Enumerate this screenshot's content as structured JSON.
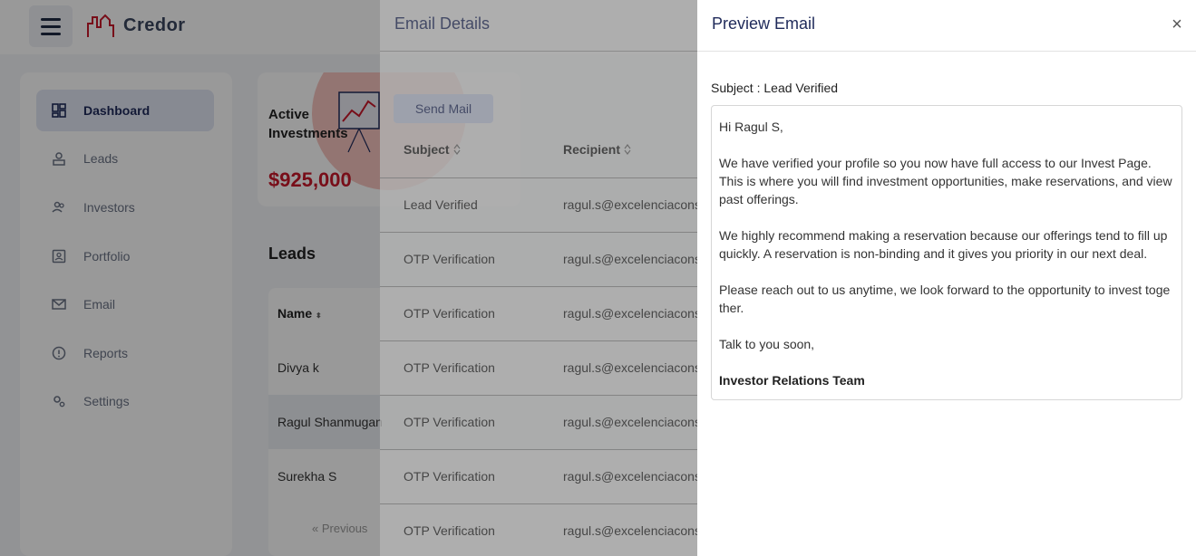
{
  "app": {
    "brand": "Credor"
  },
  "sidebar": {
    "items": [
      {
        "label": "Dashboard",
        "icon": "dashboard-icon"
      },
      {
        "label": "Leads",
        "icon": "leads-icon"
      },
      {
        "label": "Investors",
        "icon": "investors-icon"
      },
      {
        "label": "Portfolio",
        "icon": "portfolio-icon"
      },
      {
        "label": "Email",
        "icon": "email-icon"
      },
      {
        "label": "Reports",
        "icon": "reports-icon"
      },
      {
        "label": "Settings",
        "icon": "settings-icon"
      }
    ],
    "active": "Dashboard"
  },
  "dashboard": {
    "active_investments": {
      "title": "Active Investments",
      "value": "$925,000"
    },
    "leads": {
      "title": "Leads",
      "name_header": "Name",
      "rows": [
        "Divya k",
        "Ragul Shanmugan",
        "Surekha S"
      ],
      "pager_prev": "« Previous"
    }
  },
  "email_details": {
    "title": "Email Details",
    "send_button": "Send Mail",
    "columns": {
      "subject": "Subject",
      "recipient": "Recipient"
    },
    "rows": [
      {
        "subject": "Lead Verified",
        "recipient": "ragul.s@excelenciacons"
      },
      {
        "subject": "OTP Verification",
        "recipient": "ragul.s@excelenciacons"
      },
      {
        "subject": "OTP Verification",
        "recipient": "ragul.s@excelenciacons"
      },
      {
        "subject": "OTP Verification",
        "recipient": "ragul.s@excelenciacons"
      },
      {
        "subject": "OTP Verification",
        "recipient": "ragul.s@excelenciacons"
      },
      {
        "subject": "OTP Verification",
        "recipient": "ragul.s@excelenciacons"
      },
      {
        "subject": "OTP Verification",
        "recipient": "ragul.s@excelenciacons"
      }
    ]
  },
  "preview": {
    "title": "Preview Email",
    "close_icon": "×",
    "subject_line": "Subject : Lead Verified",
    "body": {
      "greeting": "Hi Ragul S,",
      "p1": "We have verified your profile so you now have full access to our Invest Page. This is where you will find investment opportunities, make reservations, and view past offerings.",
      "p2": "We highly recommend making a reservation because our offerings tend to fill up quickly. A reservation is non-binding and it gives you priority in our next deal.",
      "p3": "Please reach out to us anytime, we look forward to the opportunity to invest toge ther.",
      "closing": "Talk to you soon,",
      "signature": "Investor Relations Team"
    }
  },
  "colors": {
    "brand_dark": "#1f2a5a",
    "brand_red": "#c8182a",
    "overlay": "rgba(0,0,0,0.4)"
  }
}
